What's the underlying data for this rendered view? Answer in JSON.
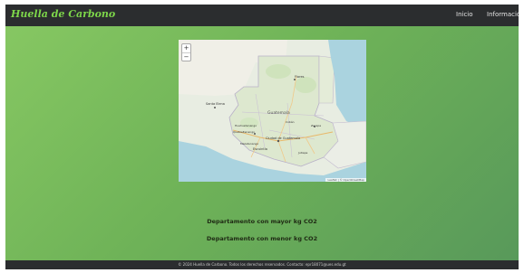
{
  "header": {
    "title": "Huella de Carbono",
    "nav": [
      "Inicio",
      "Información"
    ]
  },
  "map": {
    "zoom_in": "+",
    "zoom_out": "−",
    "labels": [
      "Flores",
      "Guatemala",
      "Ciudad de Guatemala",
      "Escuintla",
      "Santa Elena",
      "Huehuetenango",
      "Quetzaltenango",
      "Cobán",
      "Zacapa",
      "Jutiapa",
      "Mazatenango"
    ],
    "attribution": "Leaflet | © OpenStreetMap"
  },
  "stats": {
    "max_label": "Departamento con mayor kg CO2",
    "min_label": "Departamento con menor kg CO2"
  },
  "footer": {
    "text": "© 2024 Huella de Carbono. Todos los derechos reservados. Contacto: epr18071@ues.edu.gt"
  },
  "colors": {
    "navbar": "#2b2d2f",
    "brand": "#7dd64a",
    "background_start": "#86c762",
    "background_end": "#58995a"
  }
}
